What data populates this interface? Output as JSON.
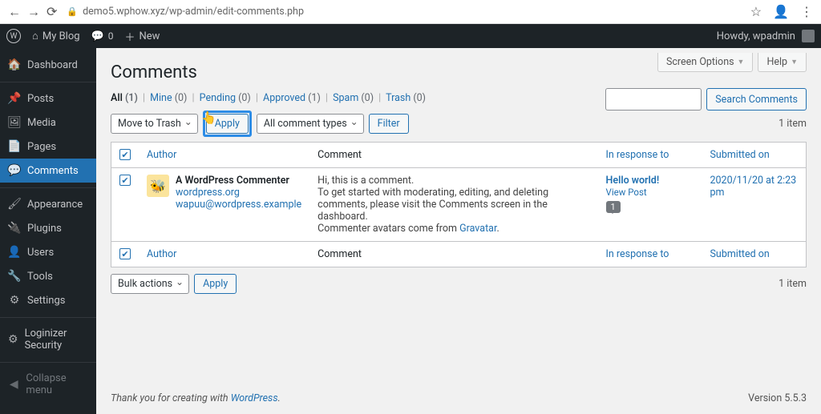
{
  "browser": {
    "url": "demo5.wphow.xyz/wp-admin/edit-comments.php"
  },
  "adminbar": {
    "site_name": "My Blog",
    "comment_count": "0",
    "new_label": "New",
    "howdy": "Howdy, wpadmin"
  },
  "sidebar": {
    "items": [
      {
        "icon": "🏠",
        "label": "Dashboard"
      },
      {
        "icon": "📌",
        "label": "Posts"
      },
      {
        "icon": "🖼",
        "label": "Media"
      },
      {
        "icon": "📄",
        "label": "Pages"
      },
      {
        "icon": "💬",
        "label": "Comments"
      },
      {
        "icon": "🖌",
        "label": "Appearance"
      },
      {
        "icon": "🔌",
        "label": "Plugins"
      },
      {
        "icon": "👤",
        "label": "Users"
      },
      {
        "icon": "🔧",
        "label": "Tools"
      },
      {
        "icon": "⚙",
        "label": "Settings"
      },
      {
        "icon": "⚙",
        "label": "Loginizer Security"
      },
      {
        "icon": "◀",
        "label": "Collapse menu"
      }
    ]
  },
  "screen_options": {
    "label": "Screen Options",
    "help": "Help"
  },
  "page_title": "Comments",
  "filters": {
    "all": "All",
    "all_cnt": "(1)",
    "mine": "Mine",
    "mine_cnt": "(0)",
    "pending": "Pending",
    "pending_cnt": "(0)",
    "approved": "Approved",
    "approved_cnt": "(1)",
    "spam": "Spam",
    "spam_cnt": "(0)",
    "trash": "Trash",
    "trash_cnt": "(0)"
  },
  "search_btn": "Search Comments",
  "bulk_top": "Move to Trash",
  "apply_top": "Apply",
  "type_filter": "All comment types",
  "filter_btn": "Filter",
  "item_count_top": "1 item",
  "table": {
    "col_author": "Author",
    "col_comment": "Comment",
    "col_response": "In response to",
    "col_date": "Submitted on"
  },
  "comment": {
    "author_name": "A WordPress Commenter",
    "author_url": "wordpress.org",
    "author_email": "wapuu@wordpress.example",
    "body1": "Hi, this is a comment.",
    "body2": "To get started with moderating, editing, and deleting comments, please visit the Comments screen in the dashboard.",
    "body3a": "Commenter avatars come from ",
    "body3b": "Gravatar",
    "body3c": ".",
    "post": "Hello world!",
    "view_post": "View Post",
    "count": "1",
    "date": "2020/11/20 at 2:23 pm"
  },
  "bulk_bottom": "Bulk actions",
  "apply_bottom": "Apply",
  "item_count_bottom": "1 item",
  "footer": {
    "thank": "Thank you for creating with ",
    "wp": "WordPress",
    "dot": ".",
    "version": "Version 5.5.3"
  }
}
